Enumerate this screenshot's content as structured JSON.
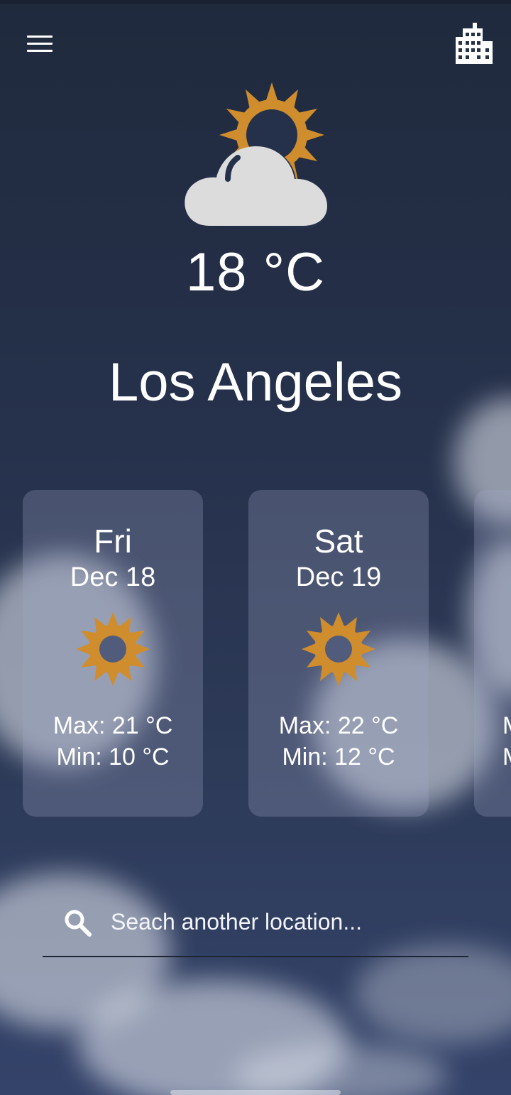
{
  "header": {
    "menu_icon": "hamburger-menu-icon",
    "city_icon": "city-buildings-icon"
  },
  "current": {
    "icon": "partly-cloudy-icon",
    "temperature": "18 °C",
    "city": "Los Angeles"
  },
  "forecast": [
    {
      "day": "Fri",
      "date": "Dec 18",
      "icon": "sun-icon",
      "max": "Max: 21 °C",
      "min": "Min: 10 °C"
    },
    {
      "day": "Sat",
      "date": "Dec 19",
      "icon": "sun-icon",
      "max": "Max: 22 °C",
      "min": "Min: 12 °C"
    },
    {
      "day": "",
      "date": "",
      "icon": "",
      "max": "M",
      "min": "M"
    }
  ],
  "search": {
    "icon": "search-icon",
    "placeholder": "Seach another location..."
  },
  "colors": {
    "sun": "#cf8d2e",
    "cloud": "#dcdcdc",
    "card_bg": "rgba(160,170,200,0.28)"
  }
}
